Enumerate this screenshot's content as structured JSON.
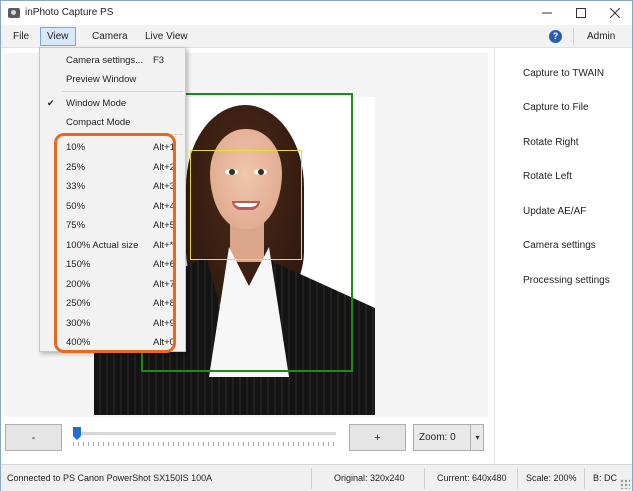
{
  "window": {
    "title": "inPhoto Capture PS",
    "minimize_icon": "minimize-icon",
    "maximize_icon": "maximize-icon",
    "close_icon": "close-icon"
  },
  "menubar": {
    "file": "File",
    "view": "View",
    "camera": "Camera",
    "live_view": "Live View",
    "help_icon": "help-icon",
    "help_glyph": "?",
    "admin": "Admin"
  },
  "view_menu": {
    "camera_settings": {
      "label": "Camera settings...",
      "shortcut": "F3"
    },
    "preview_window": {
      "label": "Preview Window"
    },
    "window_mode": {
      "label": "Window Mode",
      "checked": true,
      "check_glyph": "✔"
    },
    "compact_mode": {
      "label": "Compact Mode"
    },
    "zoom_levels": [
      {
        "label": "10%",
        "shortcut": "Alt+1"
      },
      {
        "label": "25%",
        "shortcut": "Alt+2"
      },
      {
        "label": "33%",
        "shortcut": "Alt+3"
      },
      {
        "label": "50%",
        "shortcut": "Alt+4"
      },
      {
        "label": "75%",
        "shortcut": "Alt+5"
      },
      {
        "label": "100% Actual size",
        "shortcut": "Alt+*"
      },
      {
        "label": "150%",
        "shortcut": "Alt+6"
      },
      {
        "label": "200%",
        "shortcut": "Alt+7"
      },
      {
        "label": "250%",
        "shortcut": "Alt+8"
      },
      {
        "label": "300%",
        "shortcut": "Alt+9"
      },
      {
        "label": "400%",
        "shortcut": "Alt+0"
      }
    ],
    "highlight_color": "#e8681e"
  },
  "right_panel": {
    "items": [
      "Capture to TWAIN",
      "Capture to File",
      "Rotate Right",
      "Rotate Left",
      "Update AE/AF",
      "Camera settings",
      "Processing settings"
    ]
  },
  "controls": {
    "minus_label": "-",
    "plus_label": "+",
    "zoom_label": "Zoom: 0",
    "zoom_dropdown_glyph": "▾",
    "slider_value": 0
  },
  "preview": {
    "frame_color": "#1e8a1e",
    "face_box_color": "#e6dc3a"
  },
  "statusbar": {
    "connection": "Connected to PS Canon PowerShot SX150IS 100A",
    "original": "Original: 320x240",
    "current": "Current: 640x480",
    "scale": "Scale: 200%",
    "b": "B: DC"
  }
}
